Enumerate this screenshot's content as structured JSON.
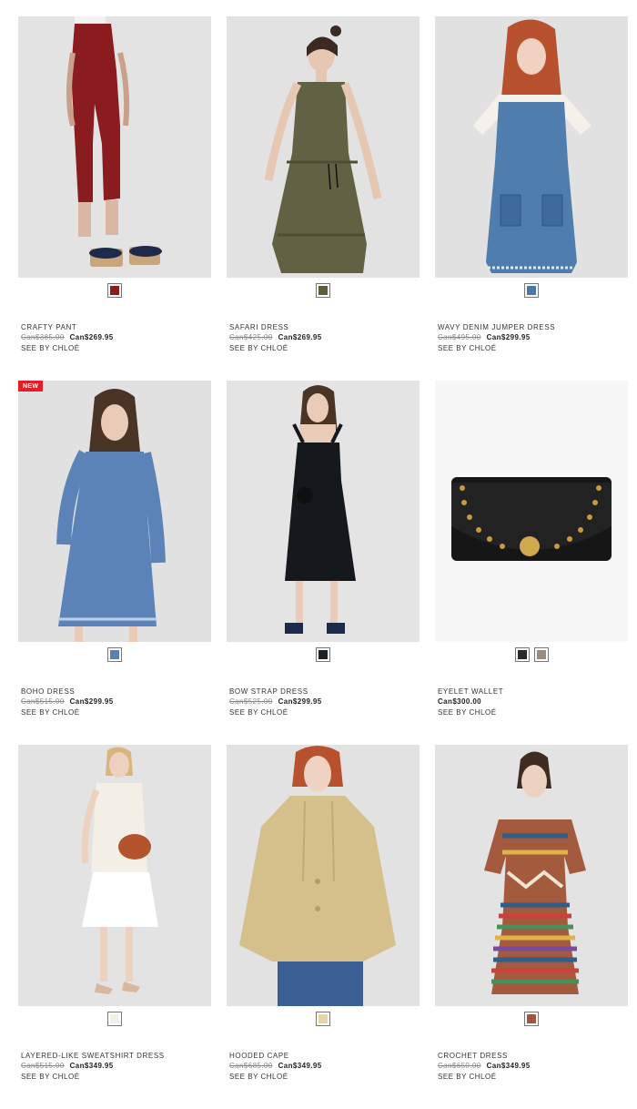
{
  "products": [
    {
      "name": "CRAFTY PANT",
      "old_price": "Can$385.00",
      "price": "Can$269.95",
      "brand": "SEE BY CHLOÉ",
      "swatches": [
        "#8d1c1f"
      ],
      "badge": ""
    },
    {
      "name": "SAFARI DRESS",
      "old_price": "Can$425.00",
      "price": "Can$269.95",
      "brand": "SEE BY CHLOÉ",
      "swatches": [
        "#5f5c3c"
      ],
      "badge": ""
    },
    {
      "name": "WAVY DENIM JUMPER DRESS",
      "old_price": "Can$495.00",
      "price": "Can$299.95",
      "brand": "SEE BY CHLOÉ",
      "swatches": [
        "#4a77a6"
      ],
      "badge": ""
    },
    {
      "name": "BOHO DRESS",
      "old_price": "Can$515.00",
      "price": "Can$299.95",
      "brand": "SEE BY CHLOÉ",
      "swatches": [
        "#5b7fb3"
      ],
      "badge": "NEW"
    },
    {
      "name": "BOW STRAP DRESS",
      "old_price": "Can$525.00",
      "price": "Can$299.95",
      "brand": "SEE BY CHLOÉ",
      "swatches": [
        "#1b2227"
      ],
      "badge": ""
    },
    {
      "name": "EYELET WALLET",
      "old_price": "",
      "price": "Can$300.00",
      "brand": "SEE BY CHLOÉ",
      "swatches": [
        "#2a2a2a",
        "#9a8c7c"
      ],
      "badge": ""
    },
    {
      "name": "LAYERED-LIKE SWEATSHIRT DRESS",
      "old_price": "Can$515.00",
      "price": "Can$349.95",
      "brand": "SEE BY CHLOÉ",
      "swatches": [
        "#f3efe6"
      ],
      "badge": ""
    },
    {
      "name": "HOODED CAPE",
      "old_price": "Can$685.00",
      "price": "Can$349.95",
      "brand": "SEE BY CHLOÉ",
      "swatches": [
        "#e6d3a8"
      ],
      "badge": ""
    },
    {
      "name": "CROCHET DRESS",
      "old_price": "Can$650.00",
      "price": "Can$349.95",
      "brand": "SEE BY CHLOÉ",
      "swatches": [
        "#a2563d"
      ],
      "badge": ""
    }
  ]
}
